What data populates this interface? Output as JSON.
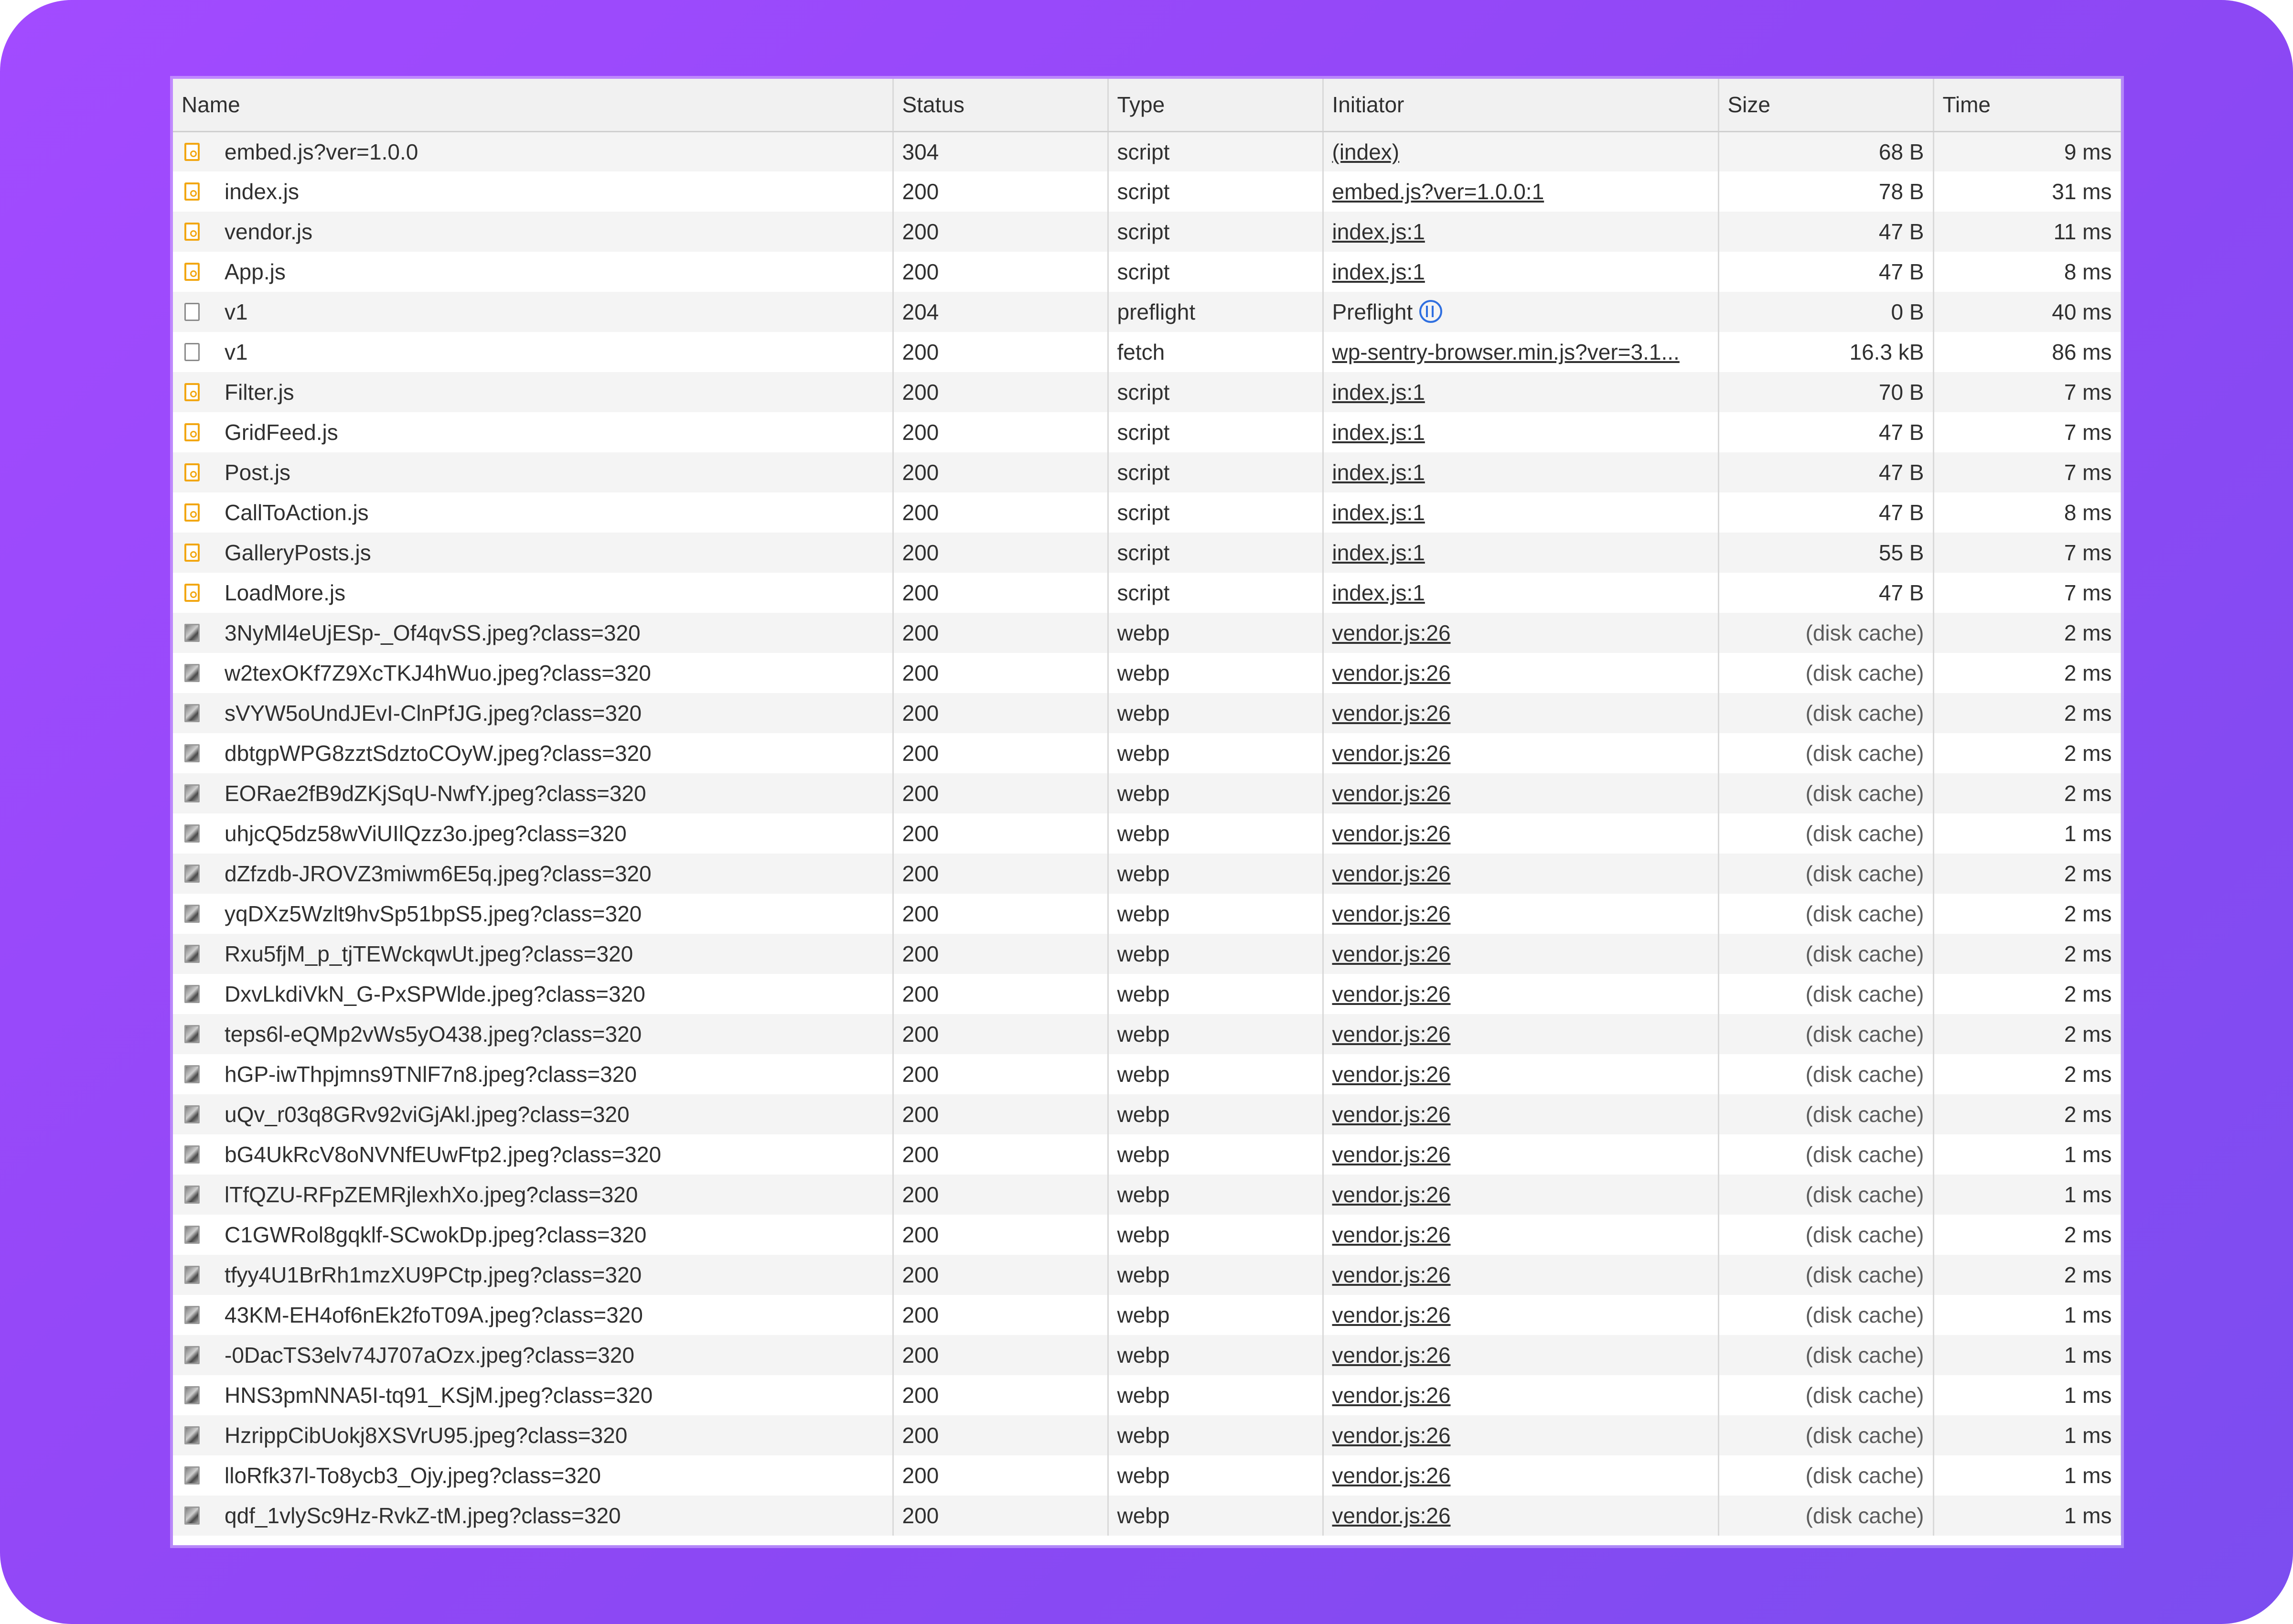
{
  "columns": {
    "name": "Name",
    "status": "Status",
    "type": "Type",
    "initiator": "Initiator",
    "size": "Size",
    "time": "Time"
  },
  "rows": [
    {
      "icon": "script-file-icon",
      "name": "embed.js?ver=1.0.0",
      "status": "304",
      "type": "script",
      "initiator": "(index)",
      "size": "68 B",
      "time": "9 ms"
    },
    {
      "icon": "script-file-icon",
      "name": "index.js",
      "status": "200",
      "type": "script",
      "initiator": "embed.js?ver=1.0.0:1",
      "size": "78 B",
      "time": "31 ms"
    },
    {
      "icon": "script-file-icon",
      "name": "vendor.js",
      "status": "200",
      "type": "script",
      "initiator": "index.js:1",
      "size": "47 B",
      "time": "11 ms"
    },
    {
      "icon": "script-file-icon",
      "name": "App.js",
      "status": "200",
      "type": "script",
      "initiator": "index.js:1",
      "size": "47 B",
      "time": "8 ms"
    },
    {
      "icon": "document-icon",
      "name": "v1",
      "status": "204",
      "type": "preflight",
      "initiator": "Preflight",
      "initiator_icon": "preflight-icon",
      "size": "0 B",
      "time": "40 ms"
    },
    {
      "icon": "document-icon",
      "name": "v1",
      "status": "200",
      "type": "fetch",
      "initiator": "wp-sentry-browser.min.js?ver=3.1...",
      "size": "16.3 kB",
      "time": "86 ms"
    },
    {
      "icon": "script-file-icon",
      "name": "Filter.js",
      "status": "200",
      "type": "script",
      "initiator": "index.js:1",
      "size": "70 B",
      "time": "7 ms"
    },
    {
      "icon": "script-file-icon",
      "name": "GridFeed.js",
      "status": "200",
      "type": "script",
      "initiator": "index.js:1",
      "size": "47 B",
      "time": "7 ms"
    },
    {
      "icon": "script-file-icon",
      "name": "Post.js",
      "status": "200",
      "type": "script",
      "initiator": "index.js:1",
      "size": "47 B",
      "time": "7 ms"
    },
    {
      "icon": "script-file-icon",
      "name": "CallToAction.js",
      "status": "200",
      "type": "script",
      "initiator": "index.js:1",
      "size": "47 B",
      "time": "8 ms"
    },
    {
      "icon": "script-file-icon",
      "name": "GalleryPosts.js",
      "status": "200",
      "type": "script",
      "initiator": "index.js:1",
      "size": "55 B",
      "time": "7 ms"
    },
    {
      "icon": "script-file-icon",
      "name": "LoadMore.js",
      "status": "200",
      "type": "script",
      "initiator": "index.js:1",
      "size": "47 B",
      "time": "7 ms"
    },
    {
      "icon": "image-thumbnail-icon",
      "name": "3NyMl4eUjESp-_Of4qvSS.jpeg?class=320",
      "status": "200",
      "type": "webp",
      "initiator": "vendor.js:26",
      "size": "(disk cache)",
      "time": "2 ms"
    },
    {
      "icon": "image-thumbnail-icon",
      "name": "w2texOKf7Z9XcTKJ4hWuo.jpeg?class=320",
      "status": "200",
      "type": "webp",
      "initiator": "vendor.js:26",
      "size": "(disk cache)",
      "time": "2 ms"
    },
    {
      "icon": "image-thumbnail-icon",
      "name": "sVYW5oUndJEvI-ClnPfJG.jpeg?class=320",
      "status": "200",
      "type": "webp",
      "initiator": "vendor.js:26",
      "size": "(disk cache)",
      "time": "2 ms"
    },
    {
      "icon": "image-thumbnail-icon",
      "name": "dbtgpWPG8zztSdztoCOyW.jpeg?class=320",
      "status": "200",
      "type": "webp",
      "initiator": "vendor.js:26",
      "size": "(disk cache)",
      "time": "2 ms"
    },
    {
      "icon": "image-thumbnail-icon",
      "name": "EORae2fB9dZKjSqU-NwfY.jpeg?class=320",
      "status": "200",
      "type": "webp",
      "initiator": "vendor.js:26",
      "size": "(disk cache)",
      "time": "2 ms"
    },
    {
      "icon": "image-thumbnail-icon",
      "name": "uhjcQ5dz58wViUIlQzz3o.jpeg?class=320",
      "status": "200",
      "type": "webp",
      "initiator": "vendor.js:26",
      "size": "(disk cache)",
      "time": "1 ms"
    },
    {
      "icon": "image-thumbnail-icon",
      "name": "dZfzdb-JROVZ3miwm6E5q.jpeg?class=320",
      "status": "200",
      "type": "webp",
      "initiator": "vendor.js:26",
      "size": "(disk cache)",
      "time": "2 ms"
    },
    {
      "icon": "image-thumbnail-icon",
      "name": "yqDXz5Wzlt9hvSp51bpS5.jpeg?class=320",
      "status": "200",
      "type": "webp",
      "initiator": "vendor.js:26",
      "size": "(disk cache)",
      "time": "2 ms"
    },
    {
      "icon": "image-thumbnail-icon",
      "name": "Rxu5fjM_p_tjTEWckqwUt.jpeg?class=320",
      "status": "200",
      "type": "webp",
      "initiator": "vendor.js:26",
      "size": "(disk cache)",
      "time": "2 ms"
    },
    {
      "icon": "image-thumbnail-icon",
      "name": "DxvLkdiVkN_G-PxSPWlde.jpeg?class=320",
      "status": "200",
      "type": "webp",
      "initiator": "vendor.js:26",
      "size": "(disk cache)",
      "time": "2 ms"
    },
    {
      "icon": "image-thumbnail-icon",
      "name": "teps6l-eQMp2vWs5yO438.jpeg?class=320",
      "status": "200",
      "type": "webp",
      "initiator": "vendor.js:26",
      "size": "(disk cache)",
      "time": "2 ms"
    },
    {
      "icon": "image-thumbnail-icon",
      "name": "hGP-iwThpjmns9TNlF7n8.jpeg?class=320",
      "status": "200",
      "type": "webp",
      "initiator": "vendor.js:26",
      "size": "(disk cache)",
      "time": "2 ms"
    },
    {
      "icon": "image-thumbnail-icon",
      "name": "uQv_r03q8GRv92viGjAkl.jpeg?class=320",
      "status": "200",
      "type": "webp",
      "initiator": "vendor.js:26",
      "size": "(disk cache)",
      "time": "2 ms"
    },
    {
      "icon": "image-thumbnail-icon",
      "name": "bG4UkRcV8oNVNfEUwFtp2.jpeg?class=320",
      "status": "200",
      "type": "webp",
      "initiator": "vendor.js:26",
      "size": "(disk cache)",
      "time": "1 ms"
    },
    {
      "icon": "image-thumbnail-icon",
      "name": "lTfQZU-RFpZEMRjlexhXo.jpeg?class=320",
      "status": "200",
      "type": "webp",
      "initiator": "vendor.js:26",
      "size": "(disk cache)",
      "time": "1 ms"
    },
    {
      "icon": "image-thumbnail-icon",
      "name": "C1GWRol8gqklf-SCwokDp.jpeg?class=320",
      "status": "200",
      "type": "webp",
      "initiator": "vendor.js:26",
      "size": "(disk cache)",
      "time": "2 ms"
    },
    {
      "icon": "image-thumbnail-icon",
      "name": "tfyy4U1BrRh1mzXU9PCtp.jpeg?class=320",
      "status": "200",
      "type": "webp",
      "initiator": "vendor.js:26",
      "size": "(disk cache)",
      "time": "2 ms"
    },
    {
      "icon": "image-thumbnail-icon",
      "name": "43KM-EH4of6nEk2foT09A.jpeg?class=320",
      "status": "200",
      "type": "webp",
      "initiator": "vendor.js:26",
      "size": "(disk cache)",
      "time": "1 ms"
    },
    {
      "icon": "image-thumbnail-icon",
      "name": "-0DacTS3elv74J707aOzx.jpeg?class=320",
      "status": "200",
      "type": "webp",
      "initiator": "vendor.js:26",
      "size": "(disk cache)",
      "time": "1 ms"
    },
    {
      "icon": "image-thumbnail-icon",
      "name": "HNS3pmNNA5I-tq91_KSjM.jpeg?class=320",
      "status": "200",
      "type": "webp",
      "initiator": "vendor.js:26",
      "size": "(disk cache)",
      "time": "1 ms"
    },
    {
      "icon": "image-thumbnail-icon",
      "name": "HzrippCibUokj8XSVrU95.jpeg?class=320",
      "status": "200",
      "type": "webp",
      "initiator": "vendor.js:26",
      "size": "(disk cache)",
      "time": "1 ms"
    },
    {
      "icon": "image-thumbnail-icon",
      "name": "lloRfk37l-To8ycb3_Ojy.jpeg?class=320",
      "status": "200",
      "type": "webp",
      "initiator": "vendor.js:26",
      "size": "(disk cache)",
      "time": "1 ms"
    },
    {
      "icon": "image-thumbnail-icon",
      "name": "qdf_1vlySc9Hz-RvkZ-tM.jpeg?class=320",
      "status": "200",
      "type": "webp",
      "initiator": "vendor.js:26",
      "size": "(disk cache)",
      "time": "1 ms"
    }
  ],
  "colors": {
    "frame_gradient_start": "#a24bff",
    "frame_gradient_end": "#7c4df0",
    "script_icon": "#f2a713",
    "preflight_icon": "#2f6fe0"
  }
}
